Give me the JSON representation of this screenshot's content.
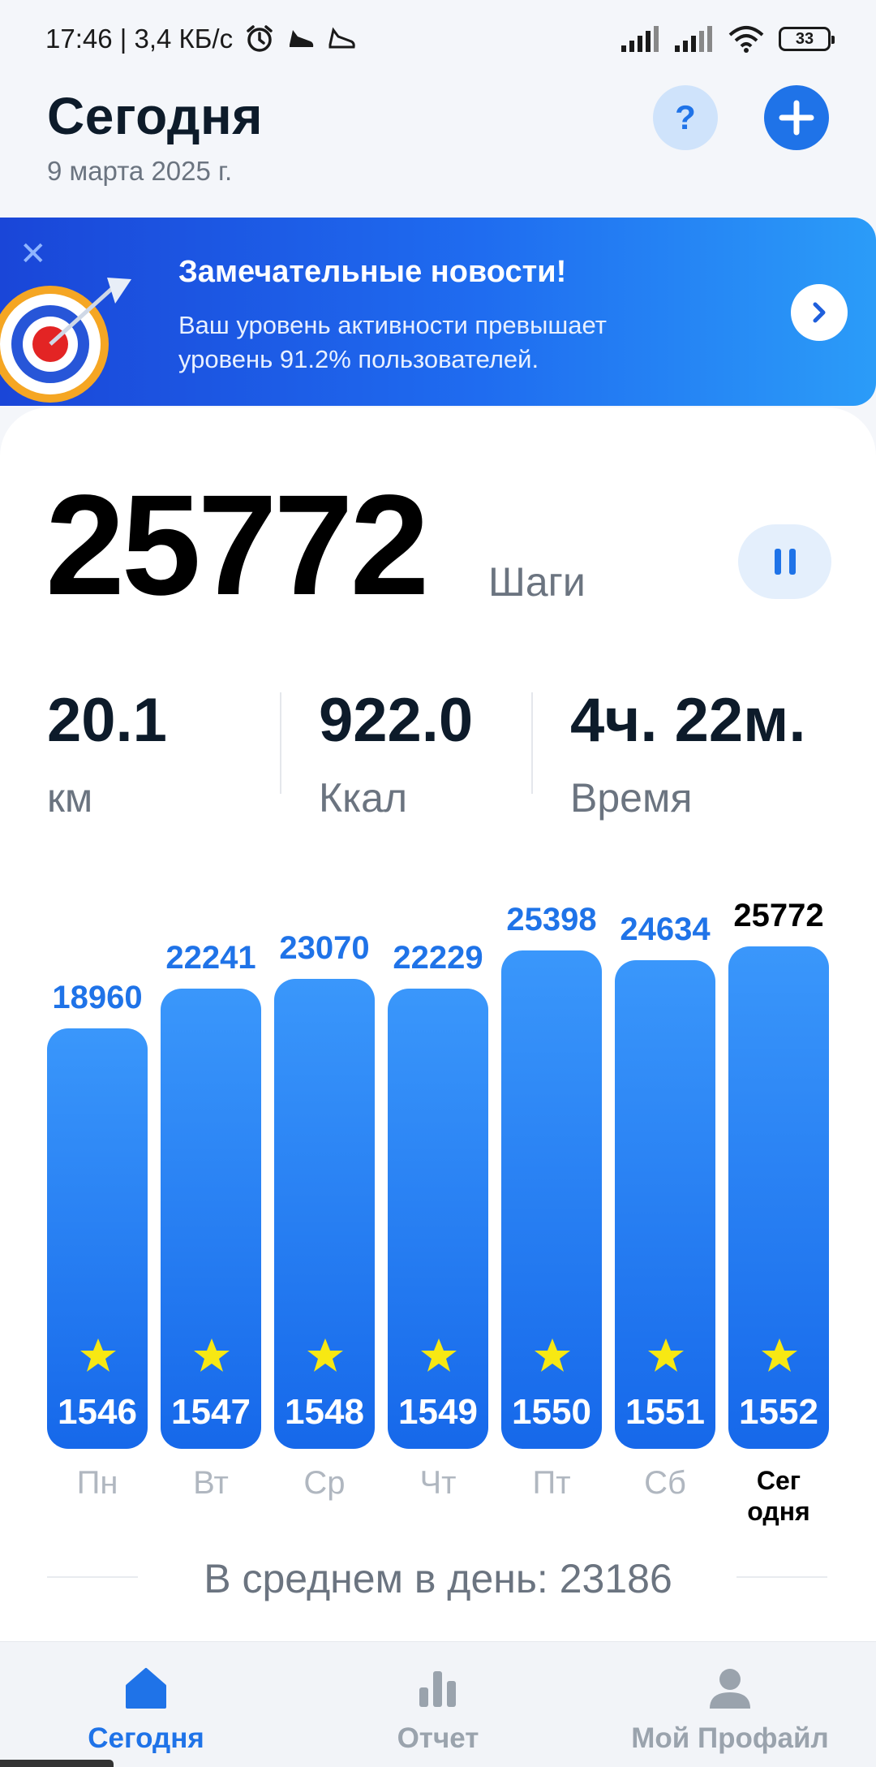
{
  "status_bar": {
    "time_speed": "17:46 | 3,4 КБ/с",
    "battery": "33"
  },
  "header": {
    "title": "Сегодня",
    "date": "9 марта 2025 г.",
    "help_label": "?"
  },
  "banner": {
    "title": "Замечательные новости!",
    "text": "Ваш уровень активности превышает уровень 91.2% пользователей."
  },
  "steps": {
    "value": "25772",
    "unit": "Шаги"
  },
  "stats": [
    {
      "value": "20.1",
      "label": "км"
    },
    {
      "value": "922.0",
      "label": "Ккал"
    },
    {
      "value": "4ч. 22м.",
      "label": "Время"
    }
  ],
  "chart_data": {
    "type": "bar",
    "categories": [
      "Пн",
      "Вт",
      "Ср",
      "Чт",
      "Пт",
      "Сб",
      "Сег одня"
    ],
    "values": [
      18960,
      22241,
      23070,
      22229,
      25398,
      24634,
      25772
    ],
    "ranks": [
      "1546",
      "1547",
      "1548",
      "1549",
      "1550",
      "1551",
      "1552"
    ],
    "value_labels": [
      "18960",
      "22241",
      "23070",
      "22229",
      "25398",
      "24634",
      "25772"
    ],
    "day_labels": [
      "Пн",
      "Вт",
      "Ср",
      "Чт",
      "Пт",
      "Сб",
      "Сег\nодня"
    ],
    "highlight_index": 6,
    "bar_color": "#1f73e8"
  },
  "average": {
    "text": "В среднем в день: 23186"
  },
  "nav": [
    {
      "label": "Сегодня",
      "icon": "home-icon",
      "active": true
    },
    {
      "label": "Отчет",
      "icon": "bar-chart-icon",
      "active": false
    },
    {
      "label": "Мой Профайл",
      "icon": "profile-icon",
      "active": false
    }
  ],
  "colors": {
    "accent": "#1f73e8",
    "today_label": "#000000"
  }
}
